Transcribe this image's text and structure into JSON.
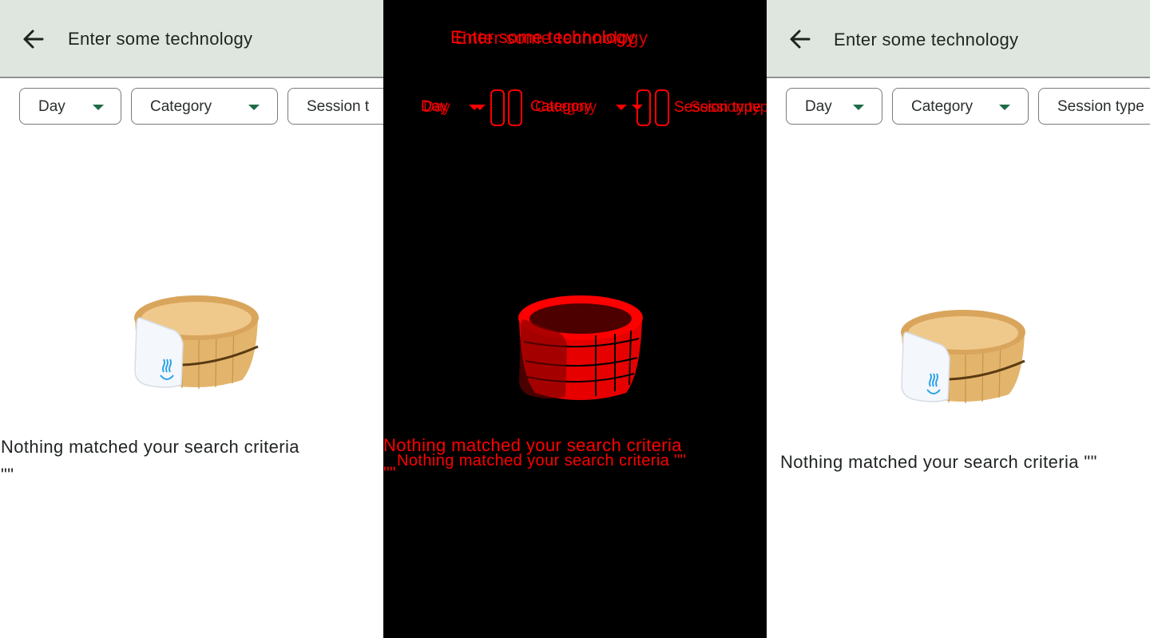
{
  "search": {
    "text": "Enter some technology"
  },
  "filters": {
    "day": "Day",
    "category": "Category",
    "session_type": "Session type"
  },
  "panel1": {
    "chip3_label": "Session t",
    "empty_line1": "Nothing matched your search criteria",
    "empty_line2": "\"\""
  },
  "panel2": {
    "chip1": "Day",
    "chip2": "Category",
    "chip3": "Session type",
    "ghost_search": "Enter some technology",
    "empty_line1": "Nothing matched your search criteria",
    "empty_line2": "\"\"",
    "empty_combined": "Nothing matched your search criteria \"\""
  },
  "panel3": {
    "empty_text": "Nothing matched your search criteria \"\""
  },
  "colors": {
    "appbar": "#dee6df",
    "accent": "#1e6b46",
    "diff": "#ff0000"
  },
  "icons": {
    "back": "arrow-back-icon",
    "dropdown": "dropdown-arrow-icon",
    "illustration": "bath-bucket-icon"
  }
}
